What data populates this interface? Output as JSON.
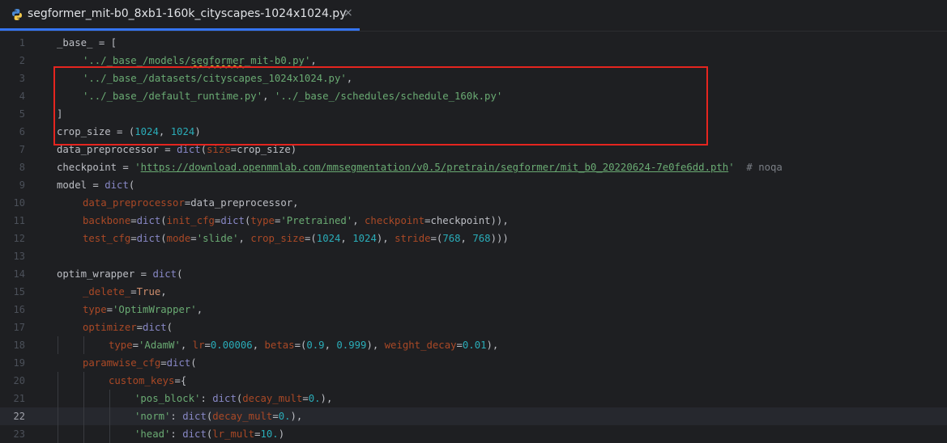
{
  "tab": {
    "filename": "segformer_mit-b0_8xb1-160k_cityscapes-1024x1024.py",
    "close_symbol": "×",
    "icon": "python-icon"
  },
  "editor": {
    "current_line": 22,
    "lines": [
      {
        "n": "1",
        "indent": 0,
        "tokens": [
          [
            "_base_",
            ""
          ],
          [
            " = [",
            ""
          ]
        ]
      },
      {
        "n": "2",
        "indent": 1,
        "tokens": [
          [
            "'../_base_/models/",
            "str"
          ],
          [
            "segformer",
            "str squiggle"
          ],
          [
            "_mit-b0.py'",
            "str"
          ],
          [
            ",",
            ""
          ]
        ]
      },
      {
        "n": "3",
        "indent": 1,
        "tokens": [
          [
            "'../_base_/datasets/cityscapes_1024x1024.py'",
            "str"
          ],
          [
            ",",
            ""
          ]
        ]
      },
      {
        "n": "4",
        "indent": 1,
        "tokens": [
          [
            "'../_base_/default_runtime.py'",
            "str"
          ],
          [
            ", ",
            ""
          ],
          [
            "'../_base_/schedules/schedule_160k.py'",
            "str"
          ]
        ]
      },
      {
        "n": "5",
        "indent": 0,
        "tokens": [
          [
            "]",
            ""
          ]
        ]
      },
      {
        "n": "6",
        "indent": 0,
        "tokens": [
          [
            "crop_size = (",
            ""
          ],
          [
            "1024",
            "num"
          ],
          [
            ", ",
            ""
          ],
          [
            "1024",
            "num"
          ],
          [
            ")",
            ""
          ]
        ]
      },
      {
        "n": "7",
        "indent": 0,
        "tokens": [
          [
            "data_preprocessor = ",
            ""
          ],
          [
            "dict",
            "builtin"
          ],
          [
            "(",
            ""
          ],
          [
            "size",
            "param"
          ],
          [
            "=crop_size)",
            ""
          ]
        ]
      },
      {
        "n": "8",
        "indent": 0,
        "tokens": [
          [
            "checkpoint = ",
            ""
          ],
          [
            "'",
            "str"
          ],
          [
            "https://download.openmmlab.com/mmsegmentation/v0.5/pretrain/segformer/mit_b0_20220624-7e0fe6dd.pth",
            "link"
          ],
          [
            "'",
            "str"
          ],
          [
            "  # noqa",
            "com"
          ]
        ]
      },
      {
        "n": "9",
        "indent": 0,
        "tokens": [
          [
            "model = ",
            ""
          ],
          [
            "dict",
            "builtin"
          ],
          [
            "(",
            ""
          ]
        ]
      },
      {
        "n": "10",
        "indent": 1,
        "tokens": [
          [
            "data_preprocessor",
            "param"
          ],
          [
            "=data_preprocessor,",
            ""
          ]
        ]
      },
      {
        "n": "11",
        "indent": 1,
        "tokens": [
          [
            "backbone",
            "param"
          ],
          [
            "=",
            ""
          ],
          [
            "dict",
            "builtin"
          ],
          [
            "(",
            ""
          ],
          [
            "init_cfg",
            "param"
          ],
          [
            "=",
            ""
          ],
          [
            "dict",
            "builtin"
          ],
          [
            "(",
            ""
          ],
          [
            "type",
            "param"
          ],
          [
            "=",
            ""
          ],
          [
            "'Pretrained'",
            "str"
          ],
          [
            ", ",
            ""
          ],
          [
            "checkpoint",
            "param"
          ],
          [
            "=checkpoint)),",
            ""
          ]
        ]
      },
      {
        "n": "12",
        "indent": 1,
        "tokens": [
          [
            "test_cfg",
            "param"
          ],
          [
            "=",
            ""
          ],
          [
            "dict",
            "builtin"
          ],
          [
            "(",
            ""
          ],
          [
            "mode",
            "param"
          ],
          [
            "=",
            ""
          ],
          [
            "'slide'",
            "str"
          ],
          [
            ", ",
            ""
          ],
          [
            "crop_size",
            "param"
          ],
          [
            "=(",
            ""
          ],
          [
            "1024",
            "num"
          ],
          [
            ", ",
            ""
          ],
          [
            "1024",
            "num"
          ],
          [
            "), ",
            ""
          ],
          [
            "stride",
            "param"
          ],
          [
            "=(",
            ""
          ],
          [
            "768",
            "num"
          ],
          [
            ", ",
            ""
          ],
          [
            "768",
            "num"
          ],
          [
            ")))",
            ""
          ]
        ]
      },
      {
        "n": "13",
        "indent": 0,
        "tokens": []
      },
      {
        "n": "14",
        "indent": 0,
        "tokens": [
          [
            "optim_wrapper = ",
            ""
          ],
          [
            "dict",
            "builtin"
          ],
          [
            "(",
            ""
          ]
        ]
      },
      {
        "n": "15",
        "indent": 1,
        "tokens": [
          [
            "_delete_",
            "param"
          ],
          [
            "=",
            ""
          ],
          [
            "True",
            "kw"
          ],
          [
            ",",
            ""
          ]
        ]
      },
      {
        "n": "16",
        "indent": 1,
        "tokens": [
          [
            "type",
            "param"
          ],
          [
            "=",
            ""
          ],
          [
            "'OptimWrapper'",
            "str"
          ],
          [
            ",",
            ""
          ]
        ]
      },
      {
        "n": "17",
        "indent": 1,
        "tokens": [
          [
            "optimizer",
            "param"
          ],
          [
            "=",
            ""
          ],
          [
            "dict",
            "builtin"
          ],
          [
            "(",
            ""
          ]
        ]
      },
      {
        "n": "18",
        "indent": 2,
        "tokens": [
          [
            "type",
            "param"
          ],
          [
            "=",
            ""
          ],
          [
            "'AdamW'",
            "str"
          ],
          [
            ", ",
            ""
          ],
          [
            "lr",
            "param"
          ],
          [
            "=",
            ""
          ],
          [
            "0.00006",
            "num"
          ],
          [
            ", ",
            ""
          ],
          [
            "betas",
            "param"
          ],
          [
            "=(",
            ""
          ],
          [
            "0.9",
            "num"
          ],
          [
            ", ",
            ""
          ],
          [
            "0.999",
            "num"
          ],
          [
            "), ",
            ""
          ],
          [
            "weight_decay",
            "param"
          ],
          [
            "=",
            ""
          ],
          [
            "0.01",
            "num"
          ],
          [
            "),",
            ""
          ]
        ]
      },
      {
        "n": "19",
        "indent": 1,
        "tokens": [
          [
            "paramwise_cfg",
            "param"
          ],
          [
            "=",
            ""
          ],
          [
            "dict",
            "builtin"
          ],
          [
            "(",
            ""
          ]
        ]
      },
      {
        "n": "20",
        "indent": 2,
        "tokens": [
          [
            "custom_keys",
            "param"
          ],
          [
            "={",
            ""
          ]
        ]
      },
      {
        "n": "21",
        "indent": 3,
        "tokens": [
          [
            "'pos_block'",
            "str"
          ],
          [
            ": ",
            ""
          ],
          [
            "dict",
            "builtin"
          ],
          [
            "(",
            ""
          ],
          [
            "decay_mult",
            "param"
          ],
          [
            "=",
            ""
          ],
          [
            "0.",
            "num"
          ],
          [
            "),",
            ""
          ]
        ]
      },
      {
        "n": "22",
        "indent": 3,
        "tokens": [
          [
            "'norm'",
            "str"
          ],
          [
            ": ",
            ""
          ],
          [
            "dict",
            "builtin"
          ],
          [
            "(",
            ""
          ],
          [
            "decay_mult",
            "param"
          ],
          [
            "=",
            ""
          ],
          [
            "0.",
            "num"
          ],
          [
            "),",
            ""
          ]
        ]
      },
      {
        "n": "23",
        "indent": 3,
        "tokens": [
          [
            "'head'",
            "str"
          ],
          [
            ": ",
            ""
          ],
          [
            "dict",
            "builtin"
          ],
          [
            "(",
            ""
          ],
          [
            "lr_mult",
            "param"
          ],
          [
            "=",
            ""
          ],
          [
            "10.",
            "num"
          ],
          [
            ")",
            ""
          ]
        ]
      }
    ]
  },
  "colors": {
    "highlight_box": "#e5251f",
    "tab_underline": "#3574f0",
    "string": "#6aab73",
    "number": "#2aacb8",
    "keyword_arg": "#aa4926",
    "builtin": "#8888c6"
  }
}
